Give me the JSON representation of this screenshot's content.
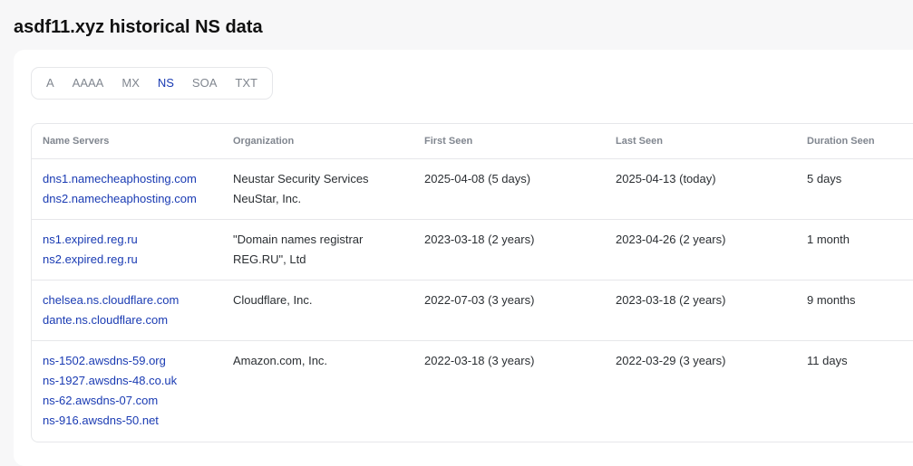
{
  "page": {
    "title": "asdf11.xyz historical NS data"
  },
  "tabs": [
    {
      "label": "A",
      "active": false
    },
    {
      "label": "AAAA",
      "active": false
    },
    {
      "label": "MX",
      "active": false
    },
    {
      "label": "NS",
      "active": true
    },
    {
      "label": "SOA",
      "active": false
    },
    {
      "label": "TXT",
      "active": false
    }
  ],
  "colors": {
    "accent": "#1a3bb3",
    "muted": "#80868f",
    "border": "#e6e7ea"
  },
  "table": {
    "headers": [
      "Name Servers",
      "Organization",
      "First Seen",
      "Last Seen",
      "Duration Seen"
    ],
    "rows": [
      {
        "name_servers": [
          "dns1.namecheaphosting.com",
          "dns2.namecheaphosting.com"
        ],
        "organization": [
          "Neustar Security Services",
          "NeuStar, Inc."
        ],
        "first_seen": "2025-04-08 (5 days)",
        "last_seen": "2025-04-13 (today)",
        "duration": "5 days"
      },
      {
        "name_servers": [
          "ns1.expired.reg.ru",
          "ns2.expired.reg.ru"
        ],
        "organization": [
          "\"Domain names registrar",
          "REG.RU\", Ltd"
        ],
        "first_seen": "2023-03-18 (2 years)",
        "last_seen": "2023-04-26 (2 years)",
        "duration": "1 month"
      },
      {
        "name_servers": [
          "chelsea.ns.cloudflare.com",
          "dante.ns.cloudflare.com"
        ],
        "organization": [
          "Cloudflare, Inc."
        ],
        "first_seen": "2022-07-03 (3 years)",
        "last_seen": "2023-03-18 (2 years)",
        "duration": "9 months"
      },
      {
        "name_servers": [
          "ns-1502.awsdns-59.org",
          "ns-1927.awsdns-48.co.uk",
          "ns-62.awsdns-07.com",
          "ns-916.awsdns-50.net"
        ],
        "organization": [
          "Amazon.com, Inc."
        ],
        "first_seen": "2022-03-18 (3 years)",
        "last_seen": "2022-03-29 (3 years)",
        "duration": "11 days"
      }
    ]
  }
}
